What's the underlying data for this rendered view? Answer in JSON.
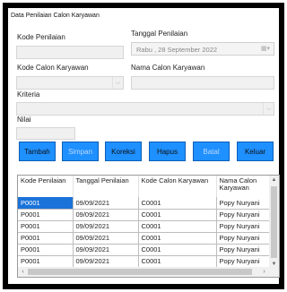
{
  "window": {
    "title": "Data Penilaian Calon Karyawan"
  },
  "form": {
    "kode_penilaian_label": "Kode Penilaian",
    "kode_penilaian_value": "",
    "tanggal_label": "Tanggal Penilaian",
    "tanggal_value": "Rabu , 28 September 2022",
    "kode_calon_label": "Kode Calon Karyawan",
    "kode_calon_value": "",
    "nama_calon_label": "Nama Calon Karyawan",
    "nama_calon_value": "",
    "kriteria_label": "Kriteria",
    "kriteria_value": "",
    "nilai_label": "Nilai",
    "nilai_value": ""
  },
  "buttons": {
    "tambah": "Tambah",
    "simpan": "Simpan",
    "koreksi": "Koreksi",
    "hapus": "Hapus",
    "batal": "Batal",
    "keluar": "Keluar"
  },
  "grid": {
    "columns": [
      "Kode Penilaian",
      "Tanggal Penilaian",
      "Kode Calon Karyawan",
      "Nama Calon Karyawan"
    ],
    "rows": [
      [
        "P0001",
        "09/09/2021",
        "C0001",
        "Popy Nuryani"
      ],
      [
        "P0001",
        "09/09/2021",
        "C0001",
        "Popy Nuryani"
      ],
      [
        "P0001",
        "09/09/2021",
        "C0001",
        "Popy Nuryani"
      ],
      [
        "P0001",
        "09/09/2021",
        "C0001",
        "Popy Nuryani"
      ],
      [
        "P0001",
        "09/09/2021",
        "C0001",
        "Popy Nuryani"
      ],
      [
        "P0001",
        "09/09/2021",
        "C0001",
        "Popy Nuryani"
      ]
    ]
  },
  "colors": {
    "button_bg": "#1e90ff",
    "selection": "#1a73d9"
  },
  "icons": {
    "combo": "chevron-down-icon",
    "calendar": "calendar-icon"
  }
}
